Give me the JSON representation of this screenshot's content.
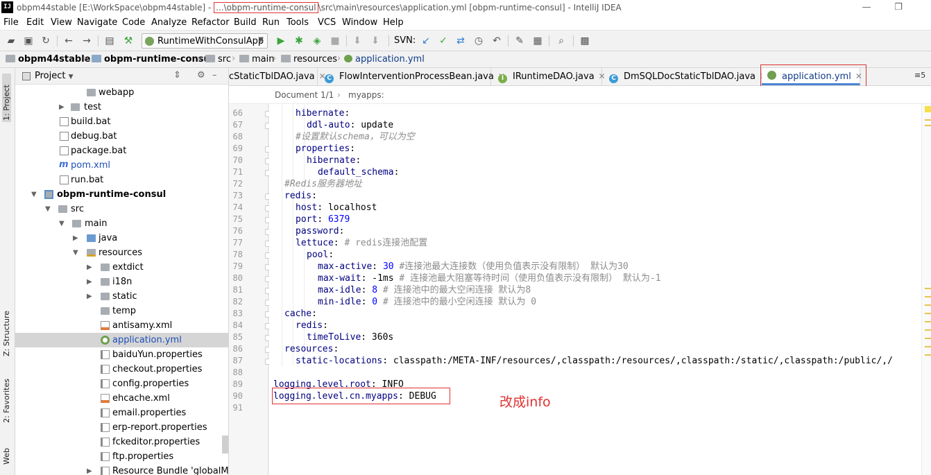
{
  "titlebar": {
    "prefix": "obpm44stable [E:\\WorkSpace\\obpm44stable] - ",
    "highlight": "...\\obpm-runtime-consul",
    "suffix": "\\src\\main\\resources\\application.yml [obpm-runtime-consul] - IntelliJ IDEA"
  },
  "menu": [
    "File",
    "Edit",
    "View",
    "Navigate",
    "Code",
    "Analyze",
    "Refactor",
    "Build",
    "Run",
    "Tools",
    "VCS",
    "Window",
    "Help"
  ],
  "toolbar": {
    "run_config": "RuntimeWithConsulApp",
    "svn_label": "SVN:"
  },
  "breadcrumb": [
    "obpm44stable",
    "obpm-runtime-consul",
    "src",
    "main",
    "resources",
    "application.yml"
  ],
  "left_strip": {
    "project": "1: Project",
    "structure": "Z: Structure",
    "favorites": "2: Favorites",
    "web": "Web"
  },
  "project_panel": {
    "title": "Project",
    "rows": [
      {
        "label": "webapp"
      },
      {
        "label": "test"
      },
      {
        "label": "build.bat"
      },
      {
        "label": "debug.bat"
      },
      {
        "label": "package.bat"
      },
      {
        "label": "pom.xml"
      },
      {
        "label": "run.bat"
      },
      {
        "label": "obpm-runtime-consul"
      },
      {
        "label": "src"
      },
      {
        "label": "main"
      },
      {
        "label": "java"
      },
      {
        "label": "resources"
      },
      {
        "label": "extdict"
      },
      {
        "label": "i18n"
      },
      {
        "label": "static"
      },
      {
        "label": "temp"
      },
      {
        "label": "antisamy.xml"
      },
      {
        "label": "application.yml"
      },
      {
        "label": "baiduYun.properties"
      },
      {
        "label": "checkout.properties"
      },
      {
        "label": "config.properties"
      },
      {
        "label": "ehcache.xml"
      },
      {
        "label": "email.properties"
      },
      {
        "label": "erp-report.properties"
      },
      {
        "label": "fckeditor.properties"
      },
      {
        "label": "ftp.properties"
      },
      {
        "label": "Resource Bundle 'globalMes"
      }
    ]
  },
  "tabs": [
    {
      "label": "cStaticTblDAO.java"
    },
    {
      "label": "FlowInterventionProcessBean.java"
    },
    {
      "label": "IRuntimeDAO.java"
    },
    {
      "label": "DmSQLDocStaticTblDAO.java"
    },
    {
      "label": "application.yml"
    }
  ],
  "tabs_more": "≡5",
  "doc_bar": {
    "document": "Document 1/1",
    "path": "myapps:"
  },
  "editor": {
    "lines": [
      {
        "n": "66",
        "key": "hibernate",
        "indent": 2,
        "rest": ":"
      },
      {
        "n": "67",
        "key": "ddl-auto",
        "indent": 3,
        "rest": ": update"
      },
      {
        "n": "68",
        "comment": "#设置默认schema，可以为空",
        "indent": 2
      },
      {
        "n": "69",
        "key": "properties",
        "indent": 2,
        "rest": ":"
      },
      {
        "n": "70",
        "key": "hibernate",
        "indent": 3,
        "rest": ":"
      },
      {
        "n": "71",
        "key": "default_schema",
        "indent": 4,
        "rest": ":"
      },
      {
        "n": "72",
        "comment": "#Redis服务器地址",
        "indent": 1
      },
      {
        "n": "73",
        "key": "redis",
        "indent": 1,
        "rest": ":"
      },
      {
        "n": "74",
        "key": "host",
        "indent": 2,
        "rest": ": localhost"
      },
      {
        "n": "75",
        "key": "port",
        "indent": 2,
        "rest": ": ",
        "num": "6379"
      },
      {
        "n": "76",
        "key": "password",
        "indent": 2,
        "rest": ":"
      },
      {
        "n": "77",
        "key": "lettuce",
        "indent": 2,
        "rest": ": ",
        "tail_comment": "# redis连接池配置"
      },
      {
        "n": "78",
        "key": "pool",
        "indent": 3,
        "rest": ":"
      },
      {
        "n": "79",
        "key": "max-active",
        "indent": 4,
        "rest": ": ",
        "num": "30",
        "tail_comment": " #连接池最大连接数（使用负值表示没有限制） 默认为30"
      },
      {
        "n": "80",
        "key": "max-wait",
        "indent": 4,
        "rest": ": -1ms ",
        "tail_comment": "# 连接池最大阻塞等待时间（使用负值表示没有限制） 默认为-1"
      },
      {
        "n": "81",
        "key": "max-idle",
        "indent": 4,
        "rest": ": ",
        "num": "8",
        "tail_comment": " # 连接池中的最大空闲连接 默认为8"
      },
      {
        "n": "82",
        "key": "min-idle",
        "indent": 4,
        "rest": ": ",
        "num": "0",
        "tail_comment": " # 连接池中的最小空闲连接 默认为 0"
      },
      {
        "n": "83",
        "key": "cache",
        "indent": 1,
        "rest": ":"
      },
      {
        "n": "84",
        "key": "redis",
        "indent": 2,
        "rest": ":"
      },
      {
        "n": "85",
        "key": "timeToLive",
        "indent": 3,
        "rest": ": 360s"
      },
      {
        "n": "86",
        "key": "resources",
        "indent": 1,
        "rest": ":"
      },
      {
        "n": "87",
        "key": "static-locations",
        "indent": 2,
        "rest": ": classpath:/META-INF/resources/,classpath:/resources/,classpath:/static/,classpath:/public/,/"
      },
      {
        "n": "88",
        "indent": 0
      },
      {
        "n": "89",
        "key": "logging.level.root",
        "indent": 0,
        "rest": ": INFO"
      },
      {
        "n": "90",
        "key": "logging.level.cn.myapps",
        "indent": 0,
        "rest": ": DEBUG"
      },
      {
        "n": "91",
        "indent": 0
      }
    ]
  },
  "annotation": "改成info",
  "colors": {
    "highlight_box": "#e03030",
    "key": "#000080",
    "number": "#0000ff",
    "comment": "#8c8c8c"
  }
}
